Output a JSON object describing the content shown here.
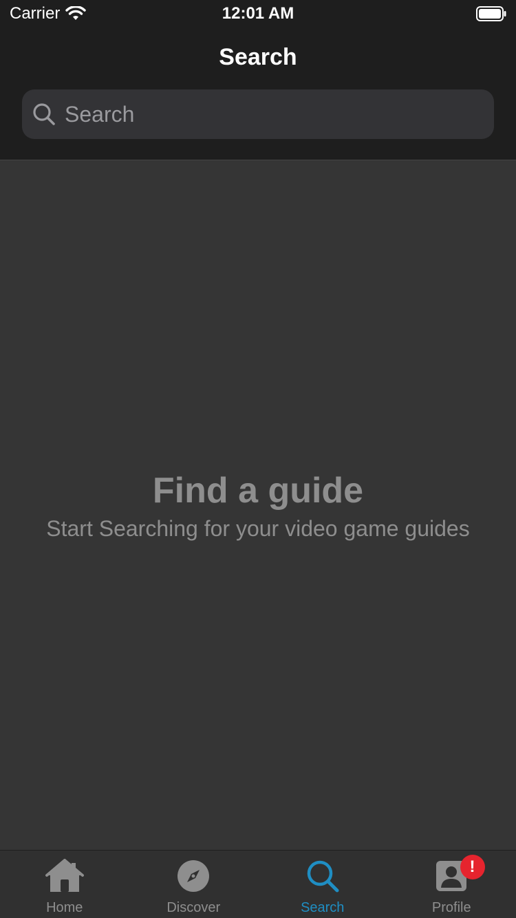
{
  "status_bar": {
    "carrier": "Carrier",
    "time": "12:01 AM"
  },
  "nav": {
    "title": "Search"
  },
  "search": {
    "placeholder": "Search",
    "value": ""
  },
  "empty_state": {
    "title": "Find a guide",
    "subtitle": "Start Searching for your video game guides"
  },
  "tabs": [
    {
      "label": "Home",
      "icon": "home-icon",
      "active": false
    },
    {
      "label": "Discover",
      "icon": "compass-icon",
      "active": false
    },
    {
      "label": "Search",
      "icon": "search-icon",
      "active": true
    },
    {
      "label": "Profile",
      "icon": "profile-icon",
      "active": false,
      "badge": "!"
    }
  ],
  "colors": {
    "accent": "#1f8ec3",
    "badge": "#e6242e",
    "background": "#353535",
    "header": "#1e1e1e"
  }
}
